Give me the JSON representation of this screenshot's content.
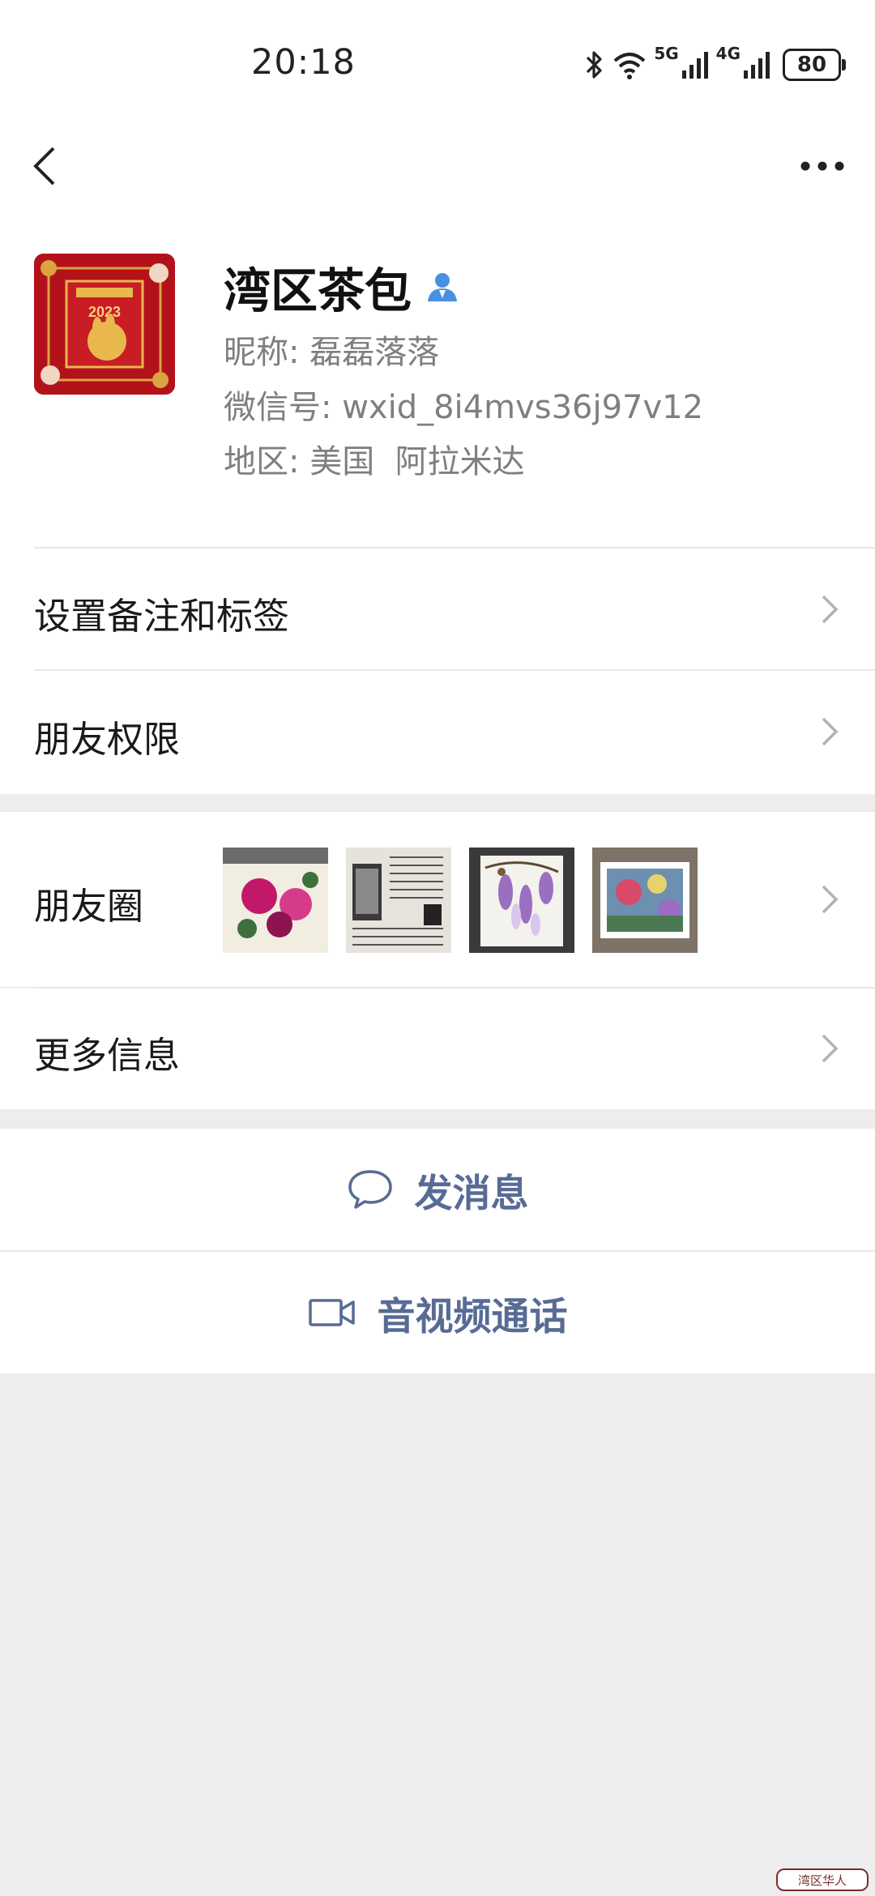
{
  "status_bar": {
    "time": "20:18",
    "network_1": "5G",
    "network_2": "4G",
    "battery": "80",
    "icons": [
      "bluetooth-icon",
      "wifi-icon",
      "signal-icon",
      "signal-icon",
      "battery-icon"
    ]
  },
  "header": {
    "back_icon": "chevron-left-icon",
    "more_icon": "more-horizontal-icon"
  },
  "profile": {
    "name": "湾区茶包",
    "nickname_label": "昵称:",
    "nickname": "磊磊落落",
    "wechat_id_label": "微信号:",
    "wechat_id": "wxid_8i4mvs36j97v12",
    "region_label": "地区:",
    "region": "美国  阿拉米达",
    "avatar_text": "2023",
    "verify_icon": "user-verified-icon"
  },
  "list": {
    "remark_label": "设置备注和标签",
    "permission_label": "朋友权限",
    "moments_label": "朋友圈",
    "more_info_label": "更多信息"
  },
  "actions": {
    "message_label": "发消息",
    "call_label": "音视频通话"
  },
  "watermark": "湾区华人",
  "colors": {
    "accent": "#576b95",
    "background": "#ededed",
    "divider": "#e8e8e8",
    "verify_blue": "#4a90e2"
  }
}
